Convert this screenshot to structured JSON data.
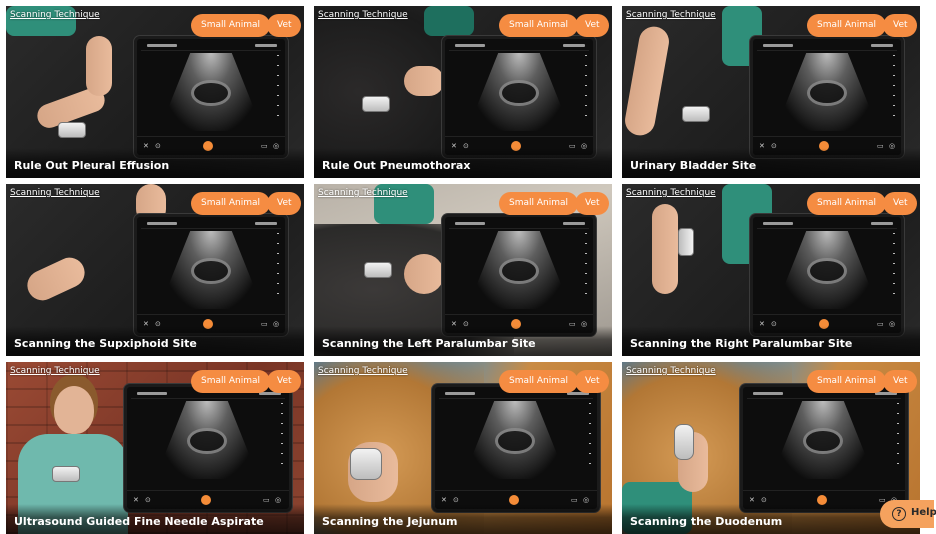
{
  "cards": [
    {
      "tag": "Scanning Technique",
      "species": "Small Animal",
      "role": "Vet",
      "title": "Rule Out Pleural Effusion"
    },
    {
      "tag": "Scanning Technique",
      "species": "Small Animal",
      "role": "Vet",
      "title": "Rule Out Pneumothorax"
    },
    {
      "tag": "Scanning Technique",
      "species": "Small Animal",
      "role": "Vet",
      "title": "Urinary Bladder Site"
    },
    {
      "tag": "Scanning Technique",
      "species": "Small Animal",
      "role": "Vet",
      "title": "Scanning the Supxiphoid Site"
    },
    {
      "tag": "Scanning Technique",
      "species": "Small Animal",
      "role": "Vet",
      "title": "Scanning the Left Paralumbar Site"
    },
    {
      "tag": "Scanning Technique",
      "species": "Small Animal",
      "role": "Vet",
      "title": "Scanning the Right Paralumbar Site"
    },
    {
      "tag": "Scanning Technique",
      "species": "Small Animal",
      "role": "Vet",
      "title": "Ultrasound Guided Fine Needle Aspirate"
    },
    {
      "tag": "Scanning Technique",
      "species": "Small Animal",
      "role": "Vet",
      "title": "Scanning the Jejunum"
    },
    {
      "tag": "Scanning Technique",
      "species": "Small Animal",
      "role": "Vet",
      "title": "Scanning the Duodenum"
    }
  ],
  "help": {
    "label": "Help",
    "icon": "question-circle-icon"
  },
  "colors": {
    "accent": "#f58c42",
    "help_bg": "#f5a25e"
  }
}
